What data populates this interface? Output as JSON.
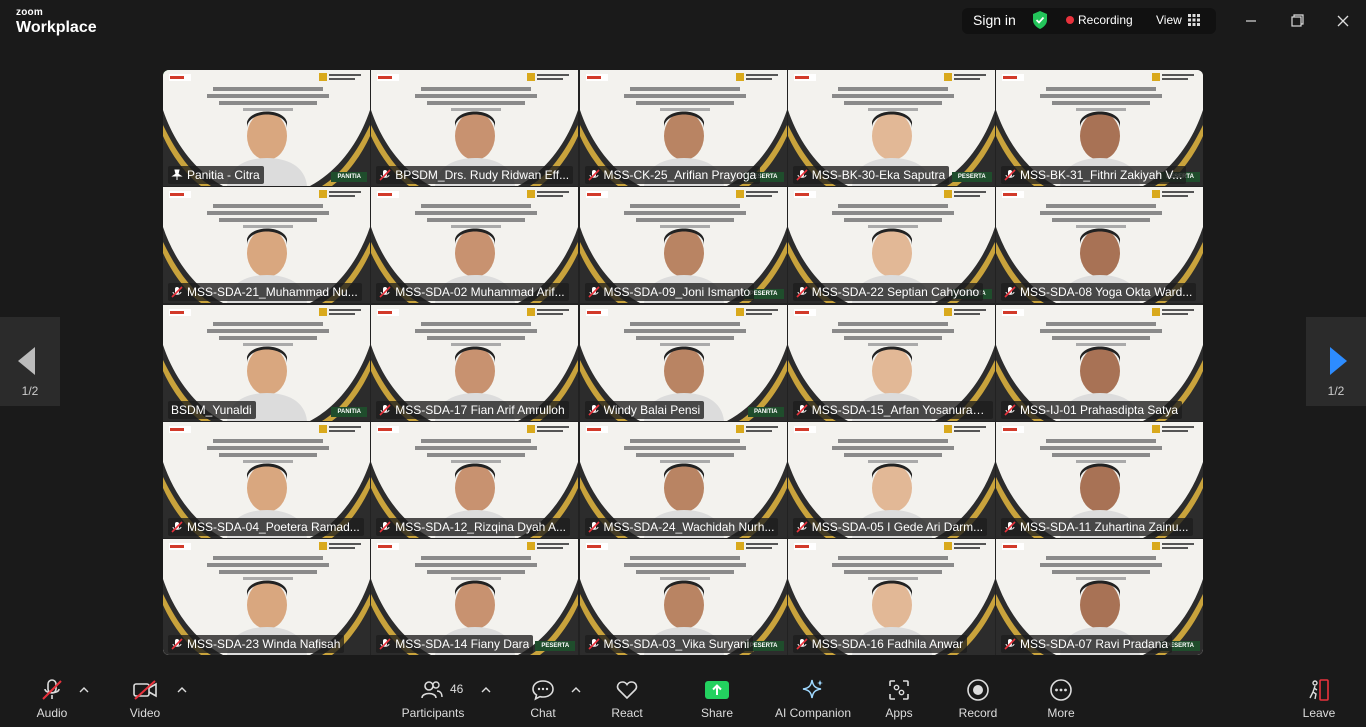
{
  "app": {
    "brand_top": "zoom",
    "brand_bottom": "Workplace"
  },
  "titlebar": {
    "signin": "Sign in",
    "recording": "Recording",
    "view": "View"
  },
  "pager": {
    "left": "1/2",
    "right": "1/2"
  },
  "participants": [
    {
      "name": "Panitia - Citra",
      "muted": false,
      "tag": "PANITIA",
      "active": true
    },
    {
      "name": "BPSDM_Drs. Rudy Ridwan Eff...",
      "muted": true,
      "tag": ""
    },
    {
      "name": "MSS-CK-25_Arifian Prayoga",
      "muted": true,
      "tag": "PESERTA"
    },
    {
      "name": "MSS-BK-30-Eka Saputra",
      "muted": true,
      "tag": "PESERTA"
    },
    {
      "name": "MSS-BK-31_Fithri Zakiyah V...",
      "muted": true,
      "tag": "PESERTA"
    },
    {
      "name": "MSS-SDA-21_Muhammad Nu...",
      "muted": true,
      "tag": ""
    },
    {
      "name": "MSS-SDA-02 Muhammad Arif...",
      "muted": true,
      "tag": ""
    },
    {
      "name": "MSS-SDA-09_Joni Ismanto",
      "muted": true,
      "tag": "PESERTA"
    },
    {
      "name": "MSS-SDA-22 Septian Cahyono",
      "muted": true,
      "tag": "PESERTA"
    },
    {
      "name": "MSS-SDA-08 Yoga Okta Ward...",
      "muted": true,
      "tag": ""
    },
    {
      "name": "BSDM_Yunaldi",
      "muted": false,
      "tag": "PANITIA"
    },
    {
      "name": "MSS-SDA-17 Fian Arif Amrulloh",
      "muted": true,
      "tag": ""
    },
    {
      "name": "Windy Balai Pensi",
      "muted": true,
      "tag": "PANITIA"
    },
    {
      "name": "MSS-SDA-15_Arfan Yosanurah...",
      "muted": true,
      "tag": ""
    },
    {
      "name": "MSS-IJ-01 Prahasdipta Satya",
      "muted": true,
      "tag": ""
    },
    {
      "name": "MSS-SDA-04_Poetera Ramad...",
      "muted": true,
      "tag": ""
    },
    {
      "name": "MSS-SDA-12_Rizqina Dyah A...",
      "muted": true,
      "tag": ""
    },
    {
      "name": "MSS-SDA-24_Wachidah Nurh...",
      "muted": true,
      "tag": ""
    },
    {
      "name": "MSS-SDA-05 I Gede Ari Darm...",
      "muted": true,
      "tag": ""
    },
    {
      "name": "MSS-SDA-11 Zuhartina Zainu...",
      "muted": true,
      "tag": ""
    },
    {
      "name": "MSS-SDA-23 Winda Nafisah",
      "muted": true,
      "tag": ""
    },
    {
      "name": "MSS-SDA-14 Fiany Dara",
      "muted": true,
      "tag": "PESERTA"
    },
    {
      "name": "MSS-SDA-03_Vika Suryani",
      "muted": true,
      "tag": "PESERTA"
    },
    {
      "name": "MSS-SDA-16 Fadhila Anwar",
      "muted": true,
      "tag": ""
    },
    {
      "name": "MSS-SDA-07 Ravi Pradana",
      "muted": true,
      "tag": "PESERTA"
    }
  ],
  "toolbar": {
    "audio": "Audio",
    "video": "Video",
    "participants": "Participants",
    "participant_count": "46",
    "chat": "Chat",
    "react": "React",
    "share": "Share",
    "ai": "AI Companion",
    "apps": "Apps",
    "record": "Record",
    "more": "More",
    "leave": "Leave"
  },
  "colors": {
    "active_outline": "#2bd45e",
    "share_green": "#23d15f",
    "mute_red": "#e8323c"
  }
}
